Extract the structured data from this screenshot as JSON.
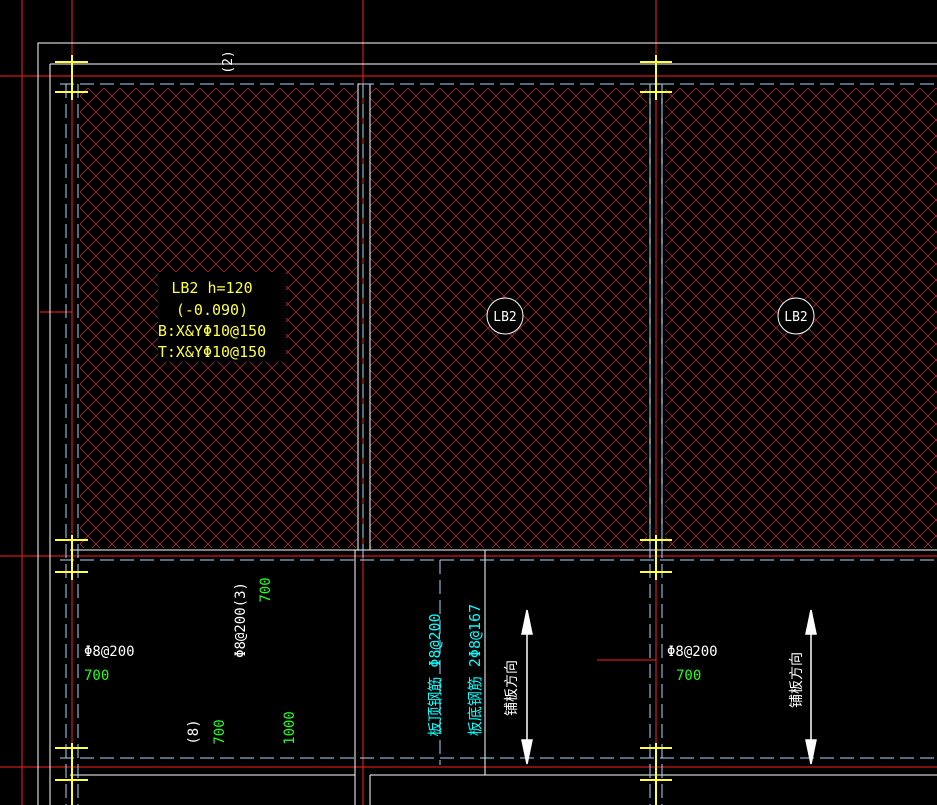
{
  "drawing": {
    "background": "#000000",
    "colors": {
      "axis": "#ff2020",
      "wall": "#ffffff",
      "dash": "#a8d8ff",
      "hatch": "#a0283c",
      "yellow": "#ffff40",
      "cyan": "#00ffff",
      "green": "#20ff20",
      "white_text": "#ffffff"
    },
    "grid_tag": "(2)",
    "slab_label": {
      "line1": "LB2  h=120",
      "line2": "(-0.090)",
      "line3": "B:X&YΦ10@150",
      "line4": "T:X&YΦ10@150"
    },
    "slab_tags": [
      "LB2",
      "LB2"
    ],
    "rebar_annotations": {
      "left_spec": "Φ8@200",
      "left_len": "700",
      "vertical_spec": "Φ8@200(3)",
      "vertical_len": "700",
      "index_tag": "(8)",
      "index_len": "700",
      "span_len": "1000",
      "top_rebar": "板顶钢筋  Φ8@200",
      "bottom_rebar": "板底钢筋  2Φ8@167",
      "direction_label": "铺板方向",
      "right_spec": "Φ8@200",
      "right_len": "700",
      "direction_label_right": "铺板方向"
    }
  }
}
